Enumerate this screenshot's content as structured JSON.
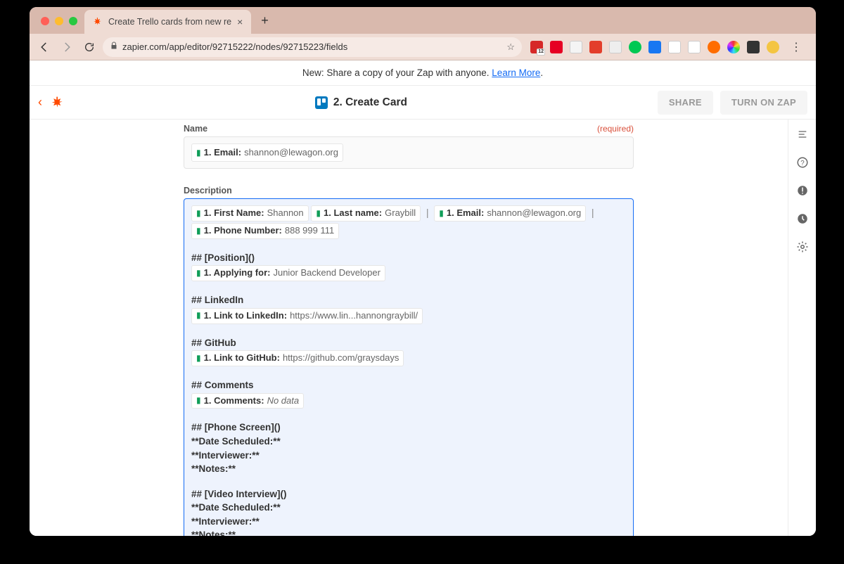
{
  "browser": {
    "tab_title": "Create Trello cards from new re",
    "url": "zapier.com/app/editor/92715222/nodes/92715223/fields",
    "ext_badge": "12"
  },
  "banner": {
    "text_prefix": "New: Share a copy of your Zap with anyone. ",
    "link": "Learn More",
    "suffix": "."
  },
  "header": {
    "step_title": "2. Create Card",
    "share": "SHARE",
    "turn_on": "TURN ON ZAP"
  },
  "name_field": {
    "label": "Name",
    "required": "(required)",
    "pill_key": "1. Email:",
    "pill_val": "shannon@lewagon.org"
  },
  "desc_field": {
    "label": "Description",
    "row1": {
      "p1_key": "1. First Name:",
      "p1_val": "Shannon",
      "p2_key": "1. Last name:",
      "p2_val": "Graybill",
      "p3_key": "1. Email:",
      "p3_val": "shannon@lewagon.org",
      "p4_key": "1. Phone Number:",
      "p4_val": "888 999 111"
    },
    "position_heading": "## [Position]()",
    "position_pill_key": "1. Applying for:",
    "position_pill_val": "Junior Backend Developer",
    "linkedin_heading": "## LinkedIn",
    "linkedin_pill_key": "1. Link to LinkedIn:",
    "linkedin_pill_val": "https://www.lin...hannongraybill/",
    "github_heading": "## GitHub",
    "github_pill_key": "1. Link to GitHub:",
    "github_pill_val": "https://github.com/graysdays",
    "comments_heading": "## Comments",
    "comments_pill_key": "1. Comments:",
    "comments_pill_val": "No data",
    "phone_heading": "## [Phone Screen]()",
    "video_heading": "## [Video Interview]()",
    "date_line": "**Date Scheduled:**",
    "interviewer_line": "**Interviewer:**",
    "notes_line": "**Notes:**"
  }
}
